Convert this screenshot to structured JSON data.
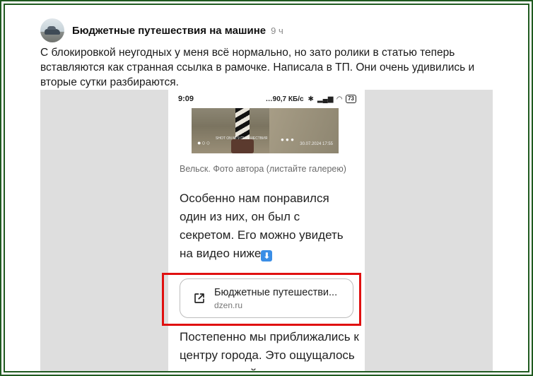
{
  "post": {
    "channel_name": "Бюджетные путешествия на машине",
    "time": "9 ч",
    "text": "С блокировкой неугодных у меня всё нормально, но зато ролики в статью теперь вставляются как странная ссылка в рамочке. Написала в ТП. Они очень удивились и вторые сутки разбираются."
  },
  "screenshot": {
    "status_bar": {
      "time": "9:09",
      "speed": "…90,7 КБ/с",
      "battery": "73"
    },
    "photo": {
      "shot_label": "SHOT ON MI 9 ПУТЕШЕСТВИЯ",
      "timestamp": "30.07.2024 17:55",
      "dots": "●○○",
      "mid_dots": "● ● ●"
    },
    "caption": "Вельск. Фото автора (листайте галерею)",
    "article_text_1": "Особенно нам понравился один из них, он был с секретом. Его можно увидеть на видео ниже",
    "arrow_emoji": "⬇",
    "link_card": {
      "title": "Бюджетные путешестви...",
      "domain": "dzen.ru"
    },
    "article_text_2": "Постепенно мы приближались к центру города. Это ощущалось по возросшей"
  },
  "colors": {
    "frame": "#1f5a1f",
    "highlight": "#e01010",
    "background_gray": "#dedede"
  }
}
